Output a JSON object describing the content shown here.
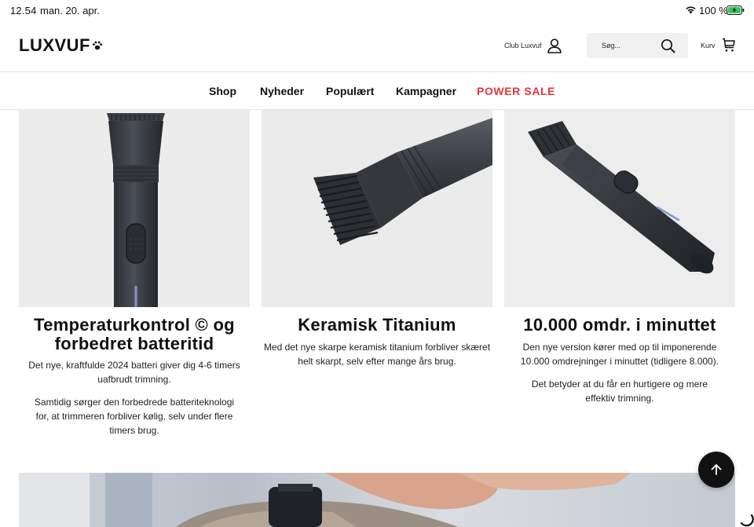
{
  "status_bar": {
    "time": "12.54",
    "date": "man. 20. apr.",
    "battery_percent": "100 %",
    "wifi_icon": "wifi-icon",
    "battery_icon": "battery-charging-icon"
  },
  "header": {
    "logo_text": "LUXVUF",
    "logo_icon": "paw-icon",
    "club_label": "Club Luxvuf",
    "search_placeholder": "Søg...",
    "cart_label": "Kurv"
  },
  "nav": {
    "items": [
      {
        "label": "Shop"
      },
      {
        "label": "Nyheder"
      },
      {
        "label": "Populært"
      },
      {
        "label": "Kampagner"
      },
      {
        "label": "POWER SALE"
      }
    ],
    "sale_color": "#e8333f"
  },
  "features": [
    {
      "title": "Temperaturkontrol © og forbedret batteritid",
      "paragraphs": [
        "Det nye, kraftfulde 2024 batteri giver dig 4-6 timers uafbrudt trimning.",
        "Samtidig sørger den forbedrede batteriteknologi for, at trimmeren forbliver kølig, selv under flere timers brug."
      ]
    },
    {
      "title": "Keramisk Titanium",
      "paragraphs": [
        "Med det nye skarpe keramisk titanium forbliver skæret helt skarpt, selv efter mange års brug."
      ]
    },
    {
      "title": "10.000 omdr. i minuttet",
      "paragraphs": [
        "Den nye version kører med op til imponerende 10.000 omdrejninger i minuttet (tidligere 8.000).",
        "Det betyder at du får en hurtigere og mere effektiv trimning."
      ]
    }
  ],
  "back_to_top_icon": "arrow-up-icon"
}
